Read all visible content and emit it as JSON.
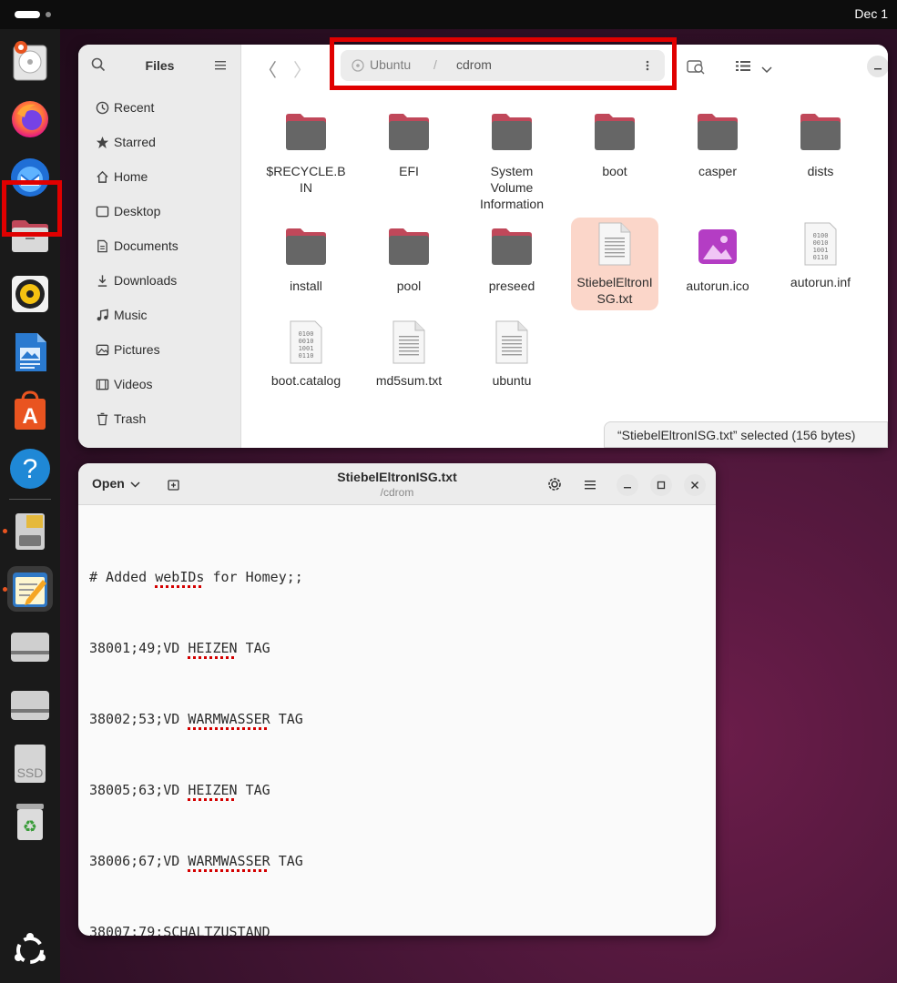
{
  "topbar": {
    "clock": "Dec 1"
  },
  "dock": {
    "apps": [
      "disk-usage-icon",
      "firefox-icon",
      "thunderbird-icon",
      "files-icon",
      "rhythmbox-icon",
      "libreoffice-writer-icon",
      "app-center-icon",
      "help-icon",
      "sd-card-icon",
      "text-editor-icon",
      "drive-icon",
      "drive-icon",
      "ssd-icon",
      "trash-icon",
      "show-apps-icon"
    ],
    "ssd_label": "SSD"
  },
  "files": {
    "title": "Files",
    "sidebar": [
      {
        "label": "Recent",
        "icon": "clock-icon"
      },
      {
        "label": "Starred",
        "icon": "star-icon"
      },
      {
        "label": "Home",
        "icon": "home-icon"
      },
      {
        "label": "Desktop",
        "icon": "desktop-icon"
      },
      {
        "label": "Documents",
        "icon": "document-icon"
      },
      {
        "label": "Downloads",
        "icon": "download-icon"
      },
      {
        "label": "Music",
        "icon": "music-icon"
      },
      {
        "label": "Pictures",
        "icon": "picture-icon"
      },
      {
        "label": "Videos",
        "icon": "video-icon"
      },
      {
        "label": "Trash",
        "icon": "trash-icon"
      }
    ],
    "path": [
      "Ubuntu",
      "/",
      "cdrom"
    ],
    "items": [
      {
        "name": "$RECYCLE.BIN",
        "type": "folder"
      },
      {
        "name": "EFI",
        "type": "folder"
      },
      {
        "name": "System Volume Information",
        "type": "folder"
      },
      {
        "name": "boot",
        "type": "folder"
      },
      {
        "name": "casper",
        "type": "folder"
      },
      {
        "name": "dists",
        "type": "folder"
      },
      {
        "name": "install",
        "type": "folder"
      },
      {
        "name": "pool",
        "type": "folder"
      },
      {
        "name": "preseed",
        "type": "folder"
      },
      {
        "name": "StiebelEltronISG.txt",
        "type": "text",
        "selected": true
      },
      {
        "name": "autorun.ico",
        "type": "image"
      },
      {
        "name": "autorun.inf",
        "type": "binary"
      },
      {
        "name": "boot.catalog",
        "type": "binary"
      },
      {
        "name": "md5sum.txt",
        "type": "text"
      },
      {
        "name": "ubuntu",
        "type": "text"
      }
    ],
    "status": "“StiebelEltronISG.txt” selected  (156 bytes)"
  },
  "editor": {
    "open_label": "Open",
    "title": "StiebelEltronISG.txt",
    "subtitle": "/cdrom",
    "lines": [
      "# Added webIDs for Homey;;",
      "38001;49;VD HEIZEN TAG",
      "38002;53;VD WARMWASSER TAG",
      "38005;63;VD HEIZEN TAG",
      "38006;67;VD WARMWASSER TAG",
      "38007;79;SCHALTZUSTAND"
    ]
  },
  "colors": {
    "accent": "#e95420",
    "highlight": "#e00000",
    "folder": "#666666",
    "folder_tab": "#c0485a"
  },
  "binary_icon_text": "0100 0010 1001 0110"
}
